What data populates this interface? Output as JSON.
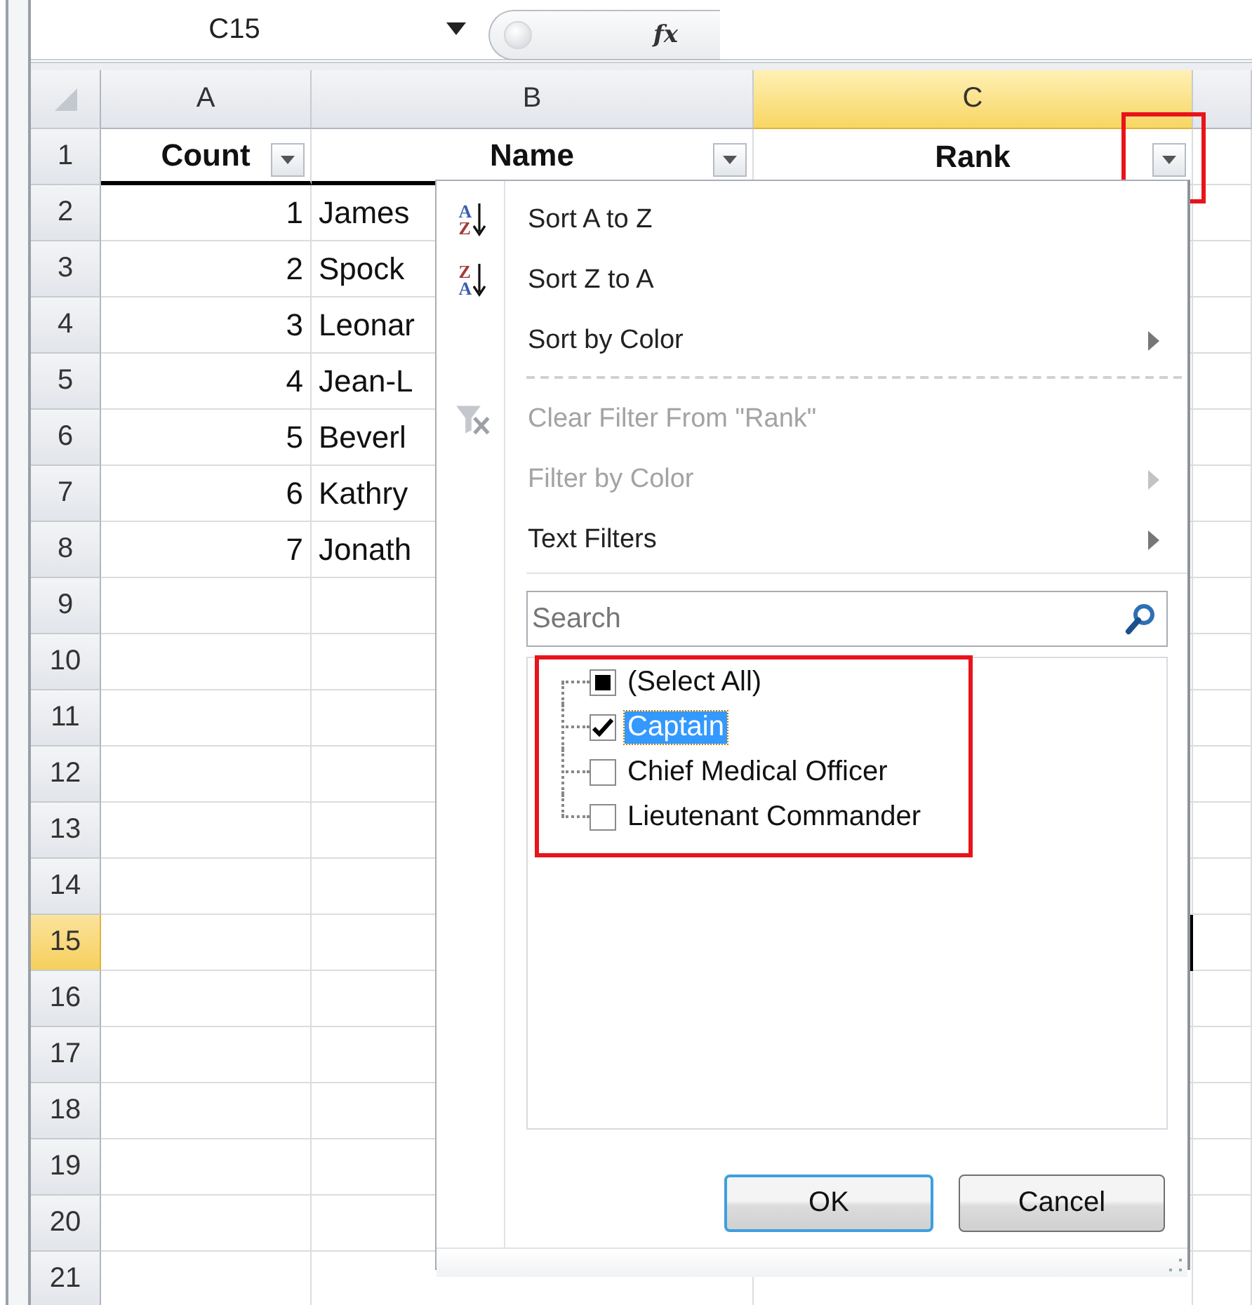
{
  "name_box": {
    "value": "C15"
  },
  "formula_bar": {
    "function_label": "fx"
  },
  "columns": [
    {
      "label": "A",
      "selected": false
    },
    {
      "label": "B",
      "selected": false
    },
    {
      "label": "C",
      "selected": true
    }
  ],
  "rows": [
    {
      "label": "1",
      "selected": false,
      "cells": [
        {
          "value": "Count",
          "kind": "header",
          "bottom_border": true,
          "highlighted": false
        },
        {
          "value": "Name",
          "kind": "header",
          "bottom_border": true,
          "highlighted": false
        },
        {
          "value": "Rank",
          "kind": "header",
          "bottom_border": false,
          "highlighted": true
        }
      ]
    },
    {
      "label": "2",
      "selected": false,
      "cells": [
        {
          "value": "1",
          "kind": "number"
        },
        {
          "value": "James",
          "kind": "text"
        }
      ]
    },
    {
      "label": "3",
      "selected": false,
      "cells": [
        {
          "value": "2",
          "kind": "number"
        },
        {
          "value": "Spock",
          "kind": "text"
        }
      ]
    },
    {
      "label": "4",
      "selected": false,
      "cells": [
        {
          "value": "3",
          "kind": "number"
        },
        {
          "value": "Leonar",
          "kind": "text"
        }
      ]
    },
    {
      "label": "5",
      "selected": false,
      "cells": [
        {
          "value": "4",
          "kind": "number"
        },
        {
          "value": "Jean-L",
          "kind": "text"
        }
      ]
    },
    {
      "label": "6",
      "selected": false,
      "cells": [
        {
          "value": "5",
          "kind": "number"
        },
        {
          "value": "Beverl",
          "kind": "text"
        }
      ]
    },
    {
      "label": "7",
      "selected": false,
      "cells": [
        {
          "value": "6",
          "kind": "number"
        },
        {
          "value": "Kathry",
          "kind": "text"
        }
      ]
    },
    {
      "label": "8",
      "selected": false,
      "cells": [
        {
          "value": "7",
          "kind": "number"
        },
        {
          "value": "Jonath",
          "kind": "text"
        }
      ]
    },
    {
      "label": "9",
      "selected": false
    },
    {
      "label": "10",
      "selected": false
    },
    {
      "label": "11",
      "selected": false
    },
    {
      "label": "12",
      "selected": false
    },
    {
      "label": "13",
      "selected": false
    },
    {
      "label": "14",
      "selected": false
    },
    {
      "label": "15",
      "selected": true
    },
    {
      "label": "16",
      "selected": false
    },
    {
      "label": "17",
      "selected": false
    },
    {
      "label": "18",
      "selected": false
    },
    {
      "label": "19",
      "selected": false
    },
    {
      "label": "20",
      "selected": false
    },
    {
      "label": "21",
      "selected": false
    }
  ],
  "filter_menu": {
    "items": [
      {
        "kind": "sort_asc",
        "label": "Sort A to Z",
        "icon_letters": [
          "A",
          "Z"
        ],
        "disabled": false,
        "submenu": false
      },
      {
        "kind": "sort_desc",
        "label": "Sort Z to A",
        "icon_letters": [
          "Z",
          "A"
        ],
        "disabled": false,
        "submenu": false
      },
      {
        "kind": "plain",
        "label": "Sort by Color",
        "disabled": false,
        "submenu": true
      },
      {
        "kind": "separator"
      },
      {
        "kind": "clear_filter",
        "label": "Clear Filter From \"Rank\"",
        "disabled": true,
        "submenu": false
      },
      {
        "kind": "plain",
        "label": "Filter by Color",
        "disabled": true,
        "submenu": true
      },
      {
        "kind": "plain",
        "label": "Text Filters",
        "disabled": false,
        "submenu": true
      }
    ],
    "search": {
      "placeholder": "Search"
    },
    "checklist": {
      "highlighted": true,
      "items": [
        {
          "label": "(Select All)",
          "checked": false,
          "indeterminate": true,
          "selected": false
        },
        {
          "label": "Captain",
          "checked": true,
          "indeterminate": false,
          "selected": true
        },
        {
          "label": "Chief Medical Officer",
          "checked": false,
          "indeterminate": false,
          "selected": false
        },
        {
          "label": "Lieutenant Commander",
          "checked": false,
          "indeterminate": false,
          "selected": false
        }
      ]
    },
    "buttons": [
      {
        "label": "OK",
        "default": true
      },
      {
        "label": "Cancel",
        "default": false
      }
    ]
  }
}
